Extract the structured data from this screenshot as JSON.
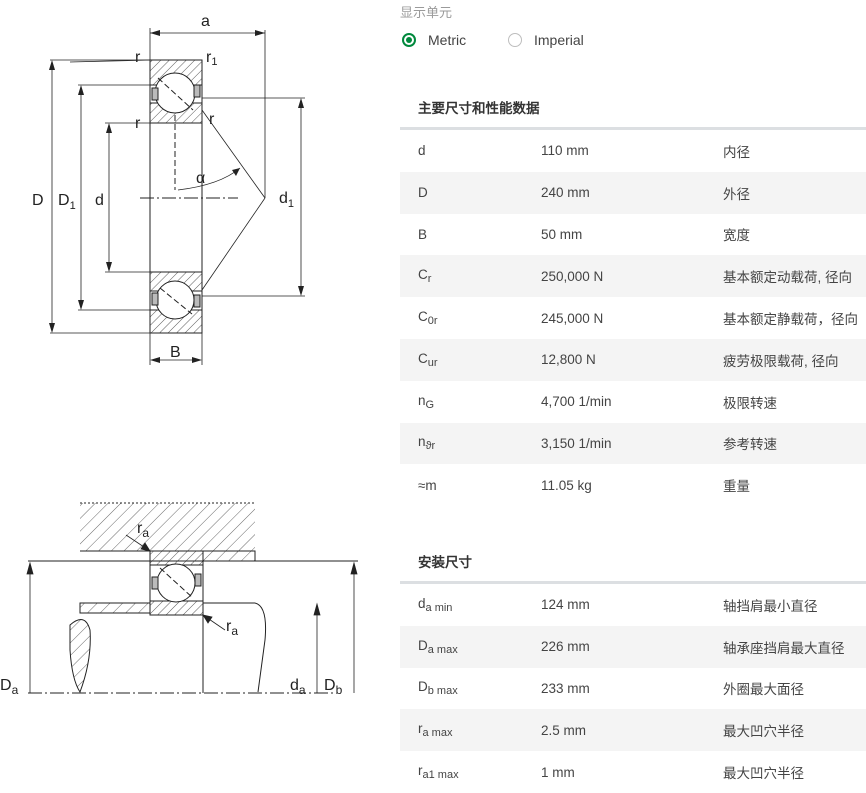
{
  "drawing": {
    "top_labels": {
      "a": "a",
      "r_left": "r",
      "r1_main": "r",
      "r1_sub": "1",
      "r_inner": "r",
      "r_right": "r",
      "alpha": "α",
      "D": "D",
      "D1_main": "D",
      "D1_sub": "1",
      "d": "d",
      "d1_main": "d",
      "d1_sub": "1",
      "B": "B"
    },
    "bottom_labels": {
      "ra_top_main": "r",
      "ra_top_sub": "a",
      "ra_bot_main": "r",
      "ra_bot_sub": "a",
      "Da_main": "D",
      "Da_sub": "a",
      "da_main": "d",
      "da_sub": "a",
      "Db_main": "D",
      "Db_sub": "b"
    }
  },
  "units": {
    "label": "显示单元",
    "options": [
      {
        "label": "Metric",
        "selected": true
      },
      {
        "label": "Imperial",
        "selected": false
      }
    ]
  },
  "main_dimensions": {
    "title": "主要尺寸和性能数据",
    "rows": [
      {
        "sym": "d",
        "sub": "",
        "value": "110 mm",
        "desc": "内径"
      },
      {
        "sym": "D",
        "sub": "",
        "value": "240 mm",
        "desc": "外径"
      },
      {
        "sym": "B",
        "sub": "",
        "value": "50 mm",
        "desc": "宽度"
      },
      {
        "sym": "C",
        "sub": "r",
        "value": "250,000 N",
        "desc": "基本额定动载荷, 径向"
      },
      {
        "sym": "C",
        "sub": "0r",
        "value": "245,000 N",
        "desc": "基本额定静载荷，径向"
      },
      {
        "sym": "C",
        "sub": "ur",
        "value": "12,800 N",
        "desc": "疲劳极限载荷, 径向"
      },
      {
        "sym": "n",
        "sub": "G",
        "value": "4,700 1/min",
        "desc": "极限转速"
      },
      {
        "sym": "n",
        "sub": "ϑr",
        "value": "3,150 1/min",
        "desc": "参考转速"
      },
      {
        "sym": "≈m",
        "sub": "",
        "value": "11.05 kg",
        "desc": "重量"
      }
    ]
  },
  "mounting_dimensions": {
    "title": "安装尺寸",
    "rows": [
      {
        "sym": "d",
        "sub": "a min",
        "value": "124 mm",
        "desc": "轴挡肩最小直径"
      },
      {
        "sym": "D",
        "sub": "a max",
        "value": "226 mm",
        "desc": "轴承座挡肩最大直径"
      },
      {
        "sym": "D",
        "sub": "b max",
        "value": "233 mm",
        "desc": "外圈最大面径"
      },
      {
        "sym": "r",
        "sub": "a max",
        "value": "2.5 mm",
        "desc": "最大凹穴半径"
      },
      {
        "sym": "r",
        "sub": "a1 max",
        "value": "1 mm",
        "desc": "最大凹穴半径"
      }
    ]
  }
}
